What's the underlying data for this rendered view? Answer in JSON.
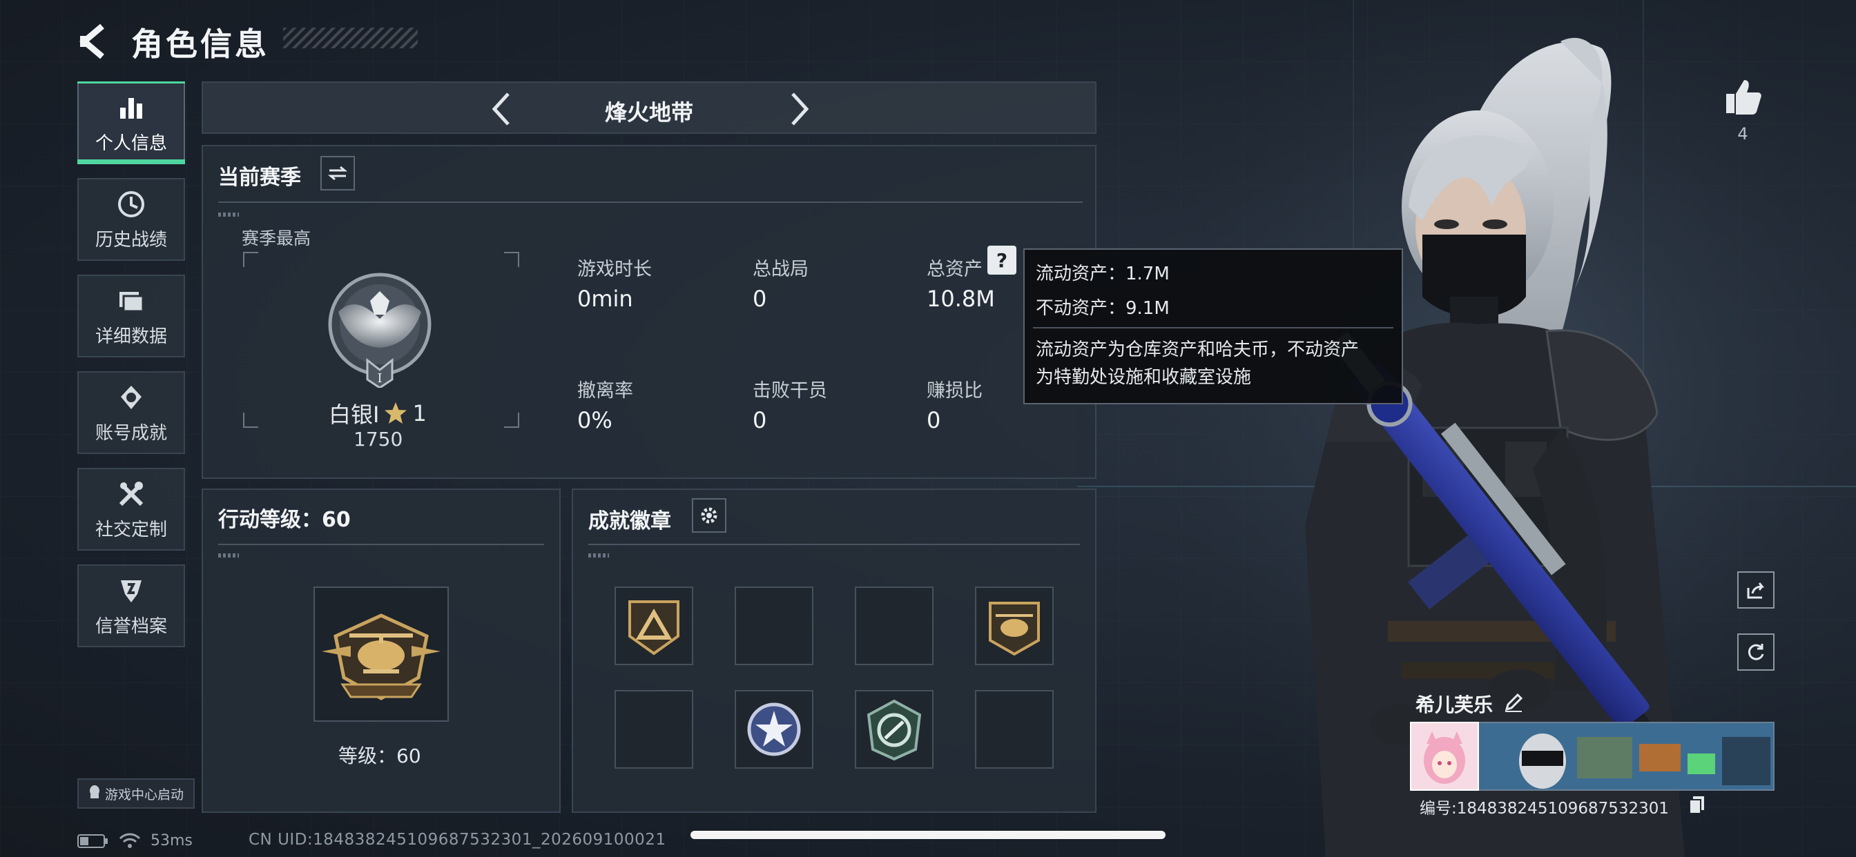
{
  "header": {
    "title": "角色信息"
  },
  "nav": {
    "items": [
      {
        "label": "个人信息",
        "icon": "bar-chart-icon",
        "active": true
      },
      {
        "label": "历史战绩",
        "icon": "clock-icon"
      },
      {
        "label": "详细数据",
        "icon": "folder-icon"
      },
      {
        "label": "账号成就",
        "icon": "medal-icon"
      },
      {
        "label": "社交定制",
        "icon": "tools-icon"
      },
      {
        "label": "信誉档案",
        "icon": "shield-icon"
      }
    ],
    "launch_label": "游戏中心启动"
  },
  "mode": {
    "title": "烽火地带"
  },
  "season": {
    "title": "当前赛季",
    "best_label": "赛季最高",
    "rank_name": "白银I",
    "rank_stars": "1",
    "rank_points": "1750",
    "rank_numeral": "I",
    "stats": {
      "playtime_label": "游戏时长",
      "playtime_value": "0min",
      "matches_label": "总战局",
      "matches_value": "0",
      "assets_label": "总资产",
      "assets_value": "10.8M",
      "extract_label": "撤离率",
      "extract_value": "0%",
      "kills_label": "击败干员",
      "kills_value": "0",
      "profit_label": "赚损比",
      "profit_value": "0"
    }
  },
  "tooltip": {
    "liquid": "流动资产：1.7M",
    "fixed": "不动资产：9.1M",
    "desc_line1": "流动资产为仓库资产和哈夫币，不动资产",
    "desc_line2": "为特勤处设施和收藏室设施"
  },
  "level": {
    "title": "行动等级：60",
    "label": "等级：60"
  },
  "achievements": {
    "title": "成就徽章"
  },
  "profile": {
    "likes": "4",
    "name": "希儿芙乐",
    "id_text": "编号:18483824510968753230​1"
  },
  "status_bar": {
    "ping": "53ms",
    "uid": "CN UID:18483824510968753230​1_202609100021"
  },
  "colors": {
    "accent": "#4fd6a0",
    "panel_bg": "#262e38",
    "border": "#3a4552"
  }
}
